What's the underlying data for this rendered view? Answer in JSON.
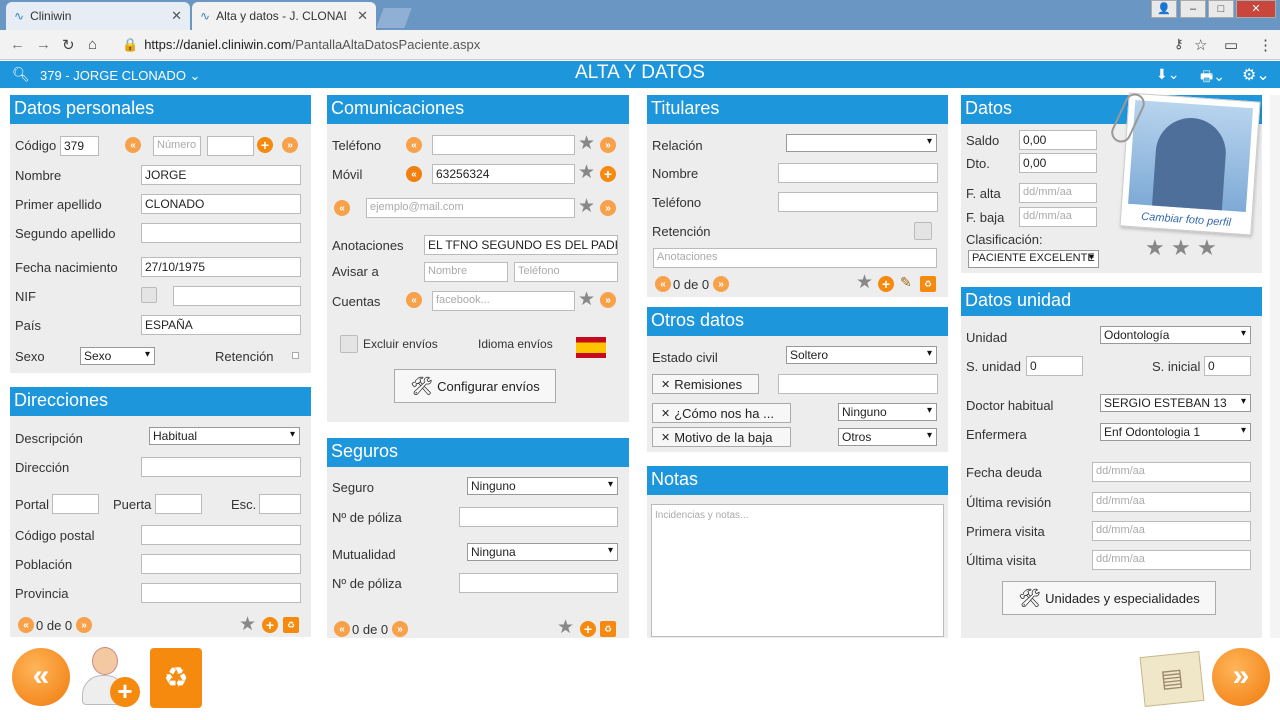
{
  "browser": {
    "tabs": [
      {
        "title": "Cliniwin"
      },
      {
        "title": "Alta y datos - J. CLONAD"
      }
    ],
    "url_host": "https://daniel.cliniwin.com",
    "url_path": "/PantallaAltaDatosPaciente.aspx"
  },
  "header": {
    "title": "ALTA Y DATOS",
    "patient": "379 - JORGE CLONADO ⌄"
  },
  "personal": {
    "title": "Datos personales",
    "codigo_label": "Código",
    "codigo": "379",
    "numero_ph": "Número",
    "nombre_label": "Nombre",
    "nombre": "JORGE",
    "apellido1_label": "Primer apellido",
    "apellido1": "CLONADO",
    "apellido2_label": "Segundo apellido",
    "fecha_label": "Fecha nacimiento",
    "fecha": "27/10/1975",
    "nif_label": "NIF",
    "pais_label": "País",
    "pais": "ESPAÑA",
    "sexo_label": "Sexo",
    "sexo": "Sexo",
    "retencion_label": "Retención"
  },
  "direcciones": {
    "title": "Direcciones",
    "descripcion_label": "Descripción",
    "descripcion": "Habitual",
    "direccion_label": "Dirección",
    "portal_label": "Portal",
    "puerta_label": "Puerta",
    "esc_label": "Esc.",
    "cp_label": "Código postal",
    "poblacion_label": "Población",
    "provincia_label": "Provincia",
    "nav": "0 de 0"
  },
  "comunicaciones": {
    "title": "Comunicaciones",
    "telefono_label": "Teléfono",
    "movil_label": "Móvil",
    "movil": "63256324",
    "email_ph": "ejemplo@mail.com",
    "anotaciones_label": "Anotaciones",
    "anotaciones": "EL TFNO SEGUNDO ES DEL PADRE",
    "avisar_label": "Avisar a",
    "nombre_ph": "Nombre",
    "telefono_ph": "Teléfono",
    "cuentas_label": "Cuentas",
    "facebook_ph": "facebook...",
    "excluir_label": "Excluir envíos",
    "idioma_label": "Idioma envíos",
    "configurar_label": "Configurar envíos"
  },
  "seguros": {
    "title": "Seguros",
    "seguro_label": "Seguro",
    "seguro": "Ninguno",
    "poliza_label": "Nº de póliza",
    "mutualidad_label": "Mutualidad",
    "mutualidad": "Ninguna",
    "poliza2_label": "Nº de póliza",
    "nav": "0 de 0"
  },
  "titulares": {
    "title": "Titulares",
    "relacion_label": "Relación",
    "nombre_label": "Nombre",
    "telefono_label": "Teléfono",
    "retencion_label": "Retención",
    "anotaciones_ph": "Anotaciones",
    "nav": "0 de 0"
  },
  "otros": {
    "title": "Otros datos",
    "estado_label": "Estado civil",
    "estado": "Soltero",
    "remisiones_label": "Remisiones",
    "como_label": "¿Cómo nos ha ...",
    "como": "Ninguno",
    "motivo_label": "Motivo de la baja",
    "motivo": "Otros"
  },
  "notas": {
    "title": "Notas",
    "placeholder": "Incidencias y notas..."
  },
  "datos": {
    "title": "Datos",
    "saldo_label": "Saldo",
    "saldo": "0,00",
    "dto_label": "Dto.",
    "dto": "0,00",
    "falta_label": "F. alta",
    "fbaja_label": "F. baja",
    "date_ph": "dd/mm/aa",
    "clasificacion_label": "Clasificación:",
    "clasificacion": "PACIENTE EXCELENTE",
    "foto_label": "Cambiar foto perfil"
  },
  "unidad": {
    "title": "Datos unidad",
    "unidad_label": "Unidad",
    "unidad": "Odontología",
    "sunidad_label": "S. unidad",
    "sunidad": "0",
    "sinicial_label": "S. inicial",
    "sinicial": "0",
    "doctor_label": "Doctor habitual",
    "doctor": "SERGIO ESTEBAN 13",
    "enfermera_label": "Enfermera",
    "enfermera": "Enf Odontologia 1",
    "deuda_label": "Fecha deuda",
    "revision_label": "Última revisión",
    "primera_label": "Primera visita",
    "ultima_label": "Última visita",
    "date_ph": "dd/mm/aa",
    "unidades_label": "Unidades y especialidades"
  }
}
